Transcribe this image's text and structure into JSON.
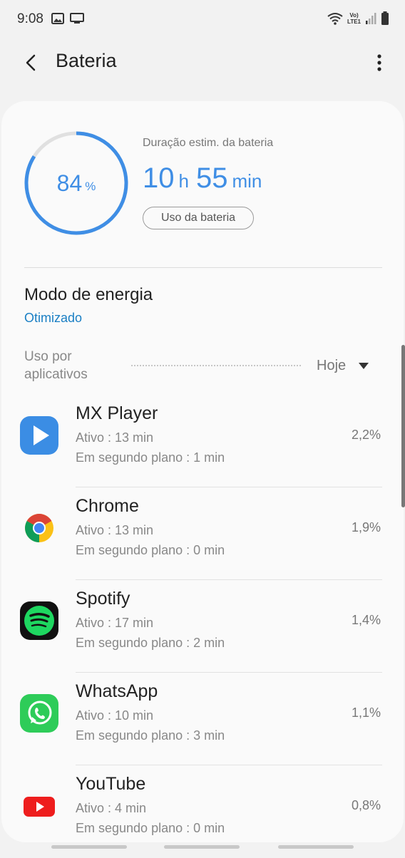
{
  "status_bar": {
    "time": "9:08",
    "lte_top": "Vo)",
    "lte_bottom": "LTE1",
    "icons": [
      "gallery-icon",
      "cast-icon",
      "wifi-icon",
      "signal-icon",
      "battery-icon"
    ]
  },
  "header": {
    "title": "Bateria",
    "back_icon": "back-arrow-icon",
    "more_icon": "more-vert-icon"
  },
  "battery": {
    "percent": "84",
    "percent_unit": "%",
    "level": 0.84,
    "estimate_label": "Duração estim. da bateria",
    "hours": "10",
    "hours_unit": "h",
    "minutes": "55",
    "minutes_unit": "min",
    "usage_button": "Uso da bateria",
    "accent_color": "#3f8ee5"
  },
  "power_mode": {
    "title": "Modo de energia",
    "value": "Otimizado"
  },
  "app_usage": {
    "label": "Uso por aplicativos",
    "period": "Hoje",
    "apps": [
      {
        "name": "MX Player",
        "active": "Ativo : 13 min",
        "background": "Em segundo plano : 1 min",
        "percent": "2,2%",
        "icon": "mx-player-icon"
      },
      {
        "name": "Chrome",
        "active": "Ativo : 13 min",
        "background": "Em segundo plano : 0 min",
        "percent": "1,9%",
        "icon": "chrome-icon"
      },
      {
        "name": "Spotify",
        "active": "Ativo : 17 min",
        "background": "Em segundo plano : 2 min",
        "percent": "1,4%",
        "icon": "spotify-icon"
      },
      {
        "name": "WhatsApp",
        "active": "Ativo : 10 min",
        "background": "Em segundo plano : 3 min",
        "percent": "1,1%",
        "icon": "whatsapp-icon"
      },
      {
        "name": "YouTube",
        "active": "Ativo : 4 min",
        "background": "Em segundo plano : 0 min",
        "percent": "0,8%",
        "icon": "youtube-icon"
      }
    ]
  }
}
